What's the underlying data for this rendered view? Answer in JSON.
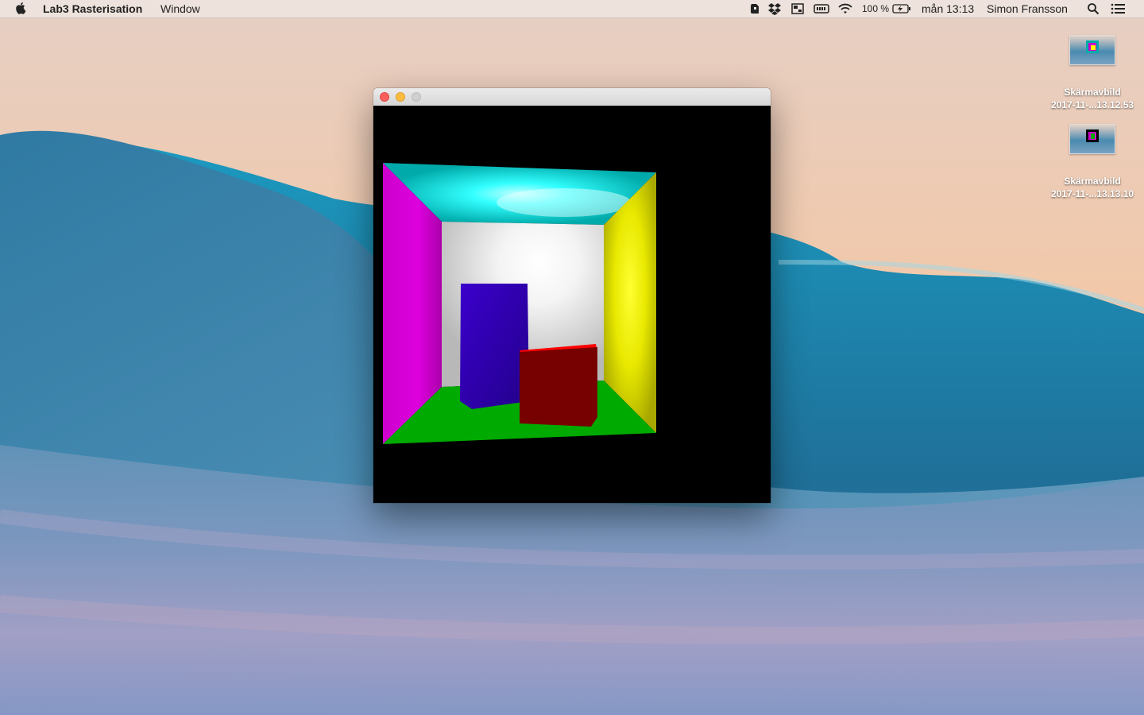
{
  "menubar": {
    "apple_icon": "apple-logo-icon",
    "app_name": "Lab3 Rasterisation",
    "menu_window": "Window",
    "battery_percent": "100 %",
    "clock": "mån 13:13",
    "user": "Simon Fransson",
    "tray_icons": [
      "evernote-icon",
      "dropbox-icon",
      "display-icon",
      "keyboard-icon",
      "wifi-icon",
      "battery-charging-icon",
      "spotlight-search-icon",
      "notification-center-icon"
    ]
  },
  "desktop": {
    "icons": [
      {
        "name": "Skärmavbild",
        "sub": "2017-11-...13.12.53"
      },
      {
        "name": "Skärmavbild",
        "sub": "2017-11-...13.13.10"
      }
    ]
  },
  "window": {
    "colors": {
      "ceiling": "#00aaaa",
      "left_wall": "#cc00cc",
      "right_wall": "#cccc00",
      "back_wall": "#d8d8d8",
      "floor": "#00aa00",
      "tall_box": "#3300aa",
      "short_box_top": "#ff0000",
      "short_box_side": "#770000",
      "background": "#000000"
    }
  }
}
